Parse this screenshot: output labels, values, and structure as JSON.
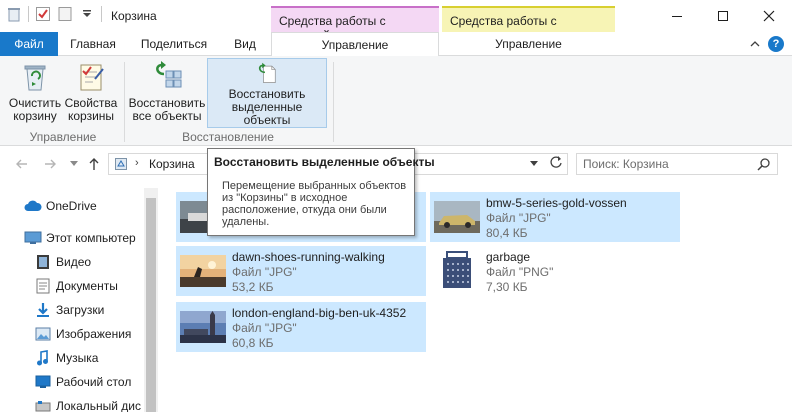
{
  "window": {
    "title": "Корзина",
    "context_groups": {
      "recycle": "Средства работы с корзиной",
      "pictures": "Средства работы с рисунками"
    },
    "colors": {
      "file_tab": "#1979ca",
      "context_pink": "#f4d8f4",
      "context_yellow": "#f7f4b5",
      "selection": "#cce8ff"
    }
  },
  "ribbon_tabs": {
    "file": "Файл",
    "home": "Главная",
    "share": "Поделиться",
    "view": "Вид",
    "manage1": "Управление",
    "manage2": "Управление"
  },
  "ribbon": {
    "empty_bin": "Очистить корзину",
    "bin_props": "Свойства корзины",
    "restore_all": "Восстановить все объекты",
    "restore_selected": "Восстановить выделенные объекты",
    "group_manage": "Управление",
    "group_restore": "Восстановление"
  },
  "address": {
    "location": "Корзина",
    "search_placeholder": "Поиск: Корзина"
  },
  "tooltip": {
    "title": "Восстановить выделенные объекты",
    "body": "Перемещение выбранных объектов из \"Корзины\" в исходное расположение, откуда они были удалены."
  },
  "sidebar": {
    "items": [
      {
        "label": "OneDrive",
        "icon": "cloud-icon"
      },
      {
        "label": "Этот компьютер",
        "icon": "computer-icon"
      },
      {
        "label": "Видео",
        "icon": "video-icon"
      },
      {
        "label": "Документы",
        "icon": "documents-icon"
      },
      {
        "label": "Загрузки",
        "icon": "downloads-icon"
      },
      {
        "label": "Изображения",
        "icon": "images-icon"
      },
      {
        "label": "Музыка",
        "icon": "music-icon"
      },
      {
        "label": "Рабочий стол",
        "icon": "desktop-icon"
      },
      {
        "label": "Локальный дис",
        "icon": "drive-icon"
      }
    ]
  },
  "files": [
    {
      "name": "",
      "type": "",
      "size": "",
      "selected": true
    },
    {
      "name": "bmw-5-series-gold-vossen",
      "type": "Файл \"JPG\"",
      "size": "80,4 КБ",
      "selected": true
    },
    {
      "name": "dawn-shoes-running-walking",
      "type": "Файл \"JPG\"",
      "size": "53,2 КБ",
      "selected": true
    },
    {
      "name": "garbage",
      "type": "Файл \"PNG\"",
      "size": "7,30 КБ",
      "selected": false
    },
    {
      "name": "london-england-big-ben-uk-4352",
      "type": "Файл \"JPG\"",
      "size": "60,8 КБ",
      "selected": true
    }
  ]
}
